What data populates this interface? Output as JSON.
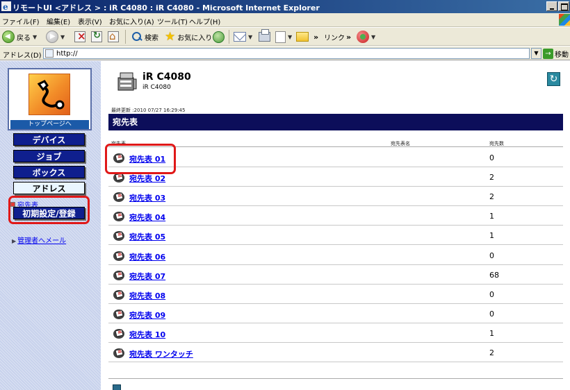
{
  "window": {
    "title": "リモートUI <アドレス > : iR C4080 : iR C4080 - Microsoft Internet Explorer"
  },
  "menu": [
    {
      "label": "ファイル(F)"
    },
    {
      "label": "編集(E)"
    },
    {
      "label": "表示(V)"
    },
    {
      "label": "お気に入り(A)"
    },
    {
      "label": "ツール(T)"
    },
    {
      "label": "ヘルプ(H)"
    }
  ],
  "toolbar": {
    "back_label": "戻る",
    "search_label": "検索",
    "favorites_label": "お気に入り",
    "links_label": "リンク"
  },
  "address": {
    "label": "アドレス(D)",
    "url": "http://",
    "go_label": "移動"
  },
  "sidebar": {
    "top_link": "トップページへ",
    "nav": [
      {
        "label": "デバイス"
      },
      {
        "label": "ジョブ"
      },
      {
        "label": "ボックス"
      },
      {
        "label": "アドレス"
      }
    ],
    "sub_item": "宛先表",
    "settings_button": "初期設定/登録",
    "admin_mail": "管理者へメール"
  },
  "device": {
    "name": "iR C4080",
    "model": "iR C4080"
  },
  "last_updated": "最終更新 :2010 07/27 16:29:45",
  "section_title": "宛先表",
  "table": {
    "headers": [
      "宛先表",
      "宛先表名",
      "宛先数"
    ],
    "rows": [
      {
        "name": "宛先表 01",
        "count": "0"
      },
      {
        "name": "宛先表 02",
        "count": "2"
      },
      {
        "name": "宛先表 03",
        "count": "2"
      },
      {
        "name": "宛先表 04",
        "count": "1"
      },
      {
        "name": "宛先表 05",
        "count": "1"
      },
      {
        "name": "宛先表 06",
        "count": "0"
      },
      {
        "name": "宛先表 07",
        "count": "68"
      },
      {
        "name": "宛先表 08",
        "count": "0"
      },
      {
        "name": "宛先表 09",
        "count": "0"
      },
      {
        "name": "宛先表 10",
        "count": "1"
      },
      {
        "name": "宛先表 ワンタッチ",
        "count": "2"
      }
    ]
  },
  "colors": {
    "nav_button": "#0f1f8e",
    "section_bar": "#0c0e5a",
    "highlight": "#e01818",
    "link": "#0000ee"
  },
  "icons": {
    "titlebar": "ie-icon",
    "device": "printer-icon",
    "reload": "refresh-icon",
    "row": "address-book-icon"
  }
}
